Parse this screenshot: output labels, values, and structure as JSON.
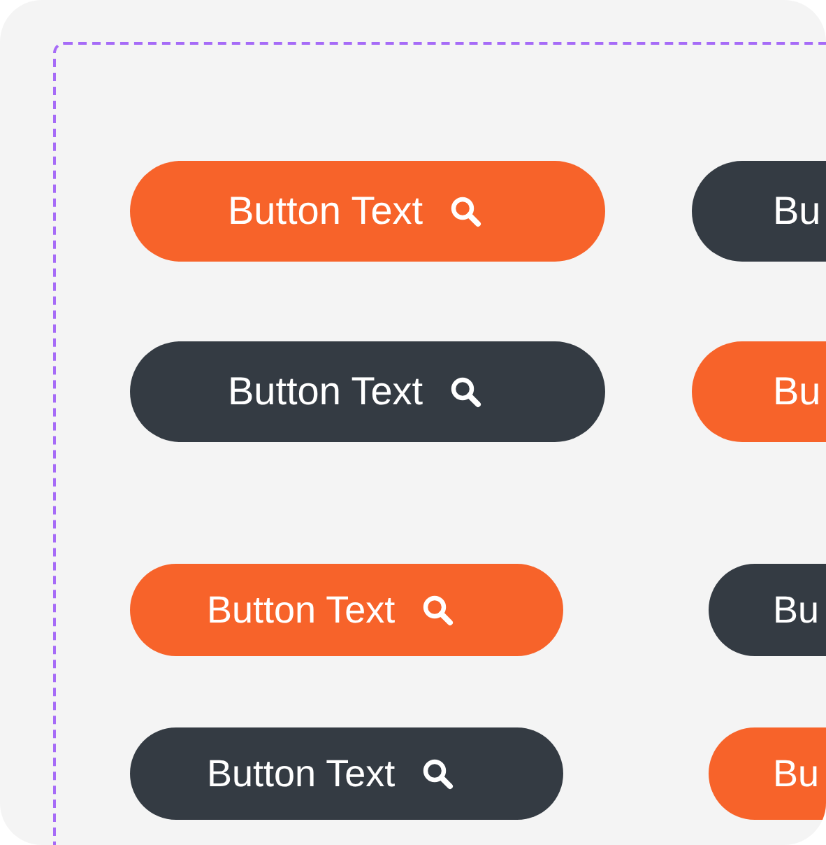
{
  "groups": [
    {
      "kind": "large",
      "rows": [
        [
          {
            "kind": "primary",
            "label": "Button Text",
            "search_icon": true
          },
          {
            "kind": "dark",
            "label": "Bu",
            "search_icon": false
          }
        ],
        [
          {
            "kind": "dark",
            "label": "Button Text",
            "search_icon": true
          },
          {
            "kind": "primary",
            "label": "Bu",
            "search_icon": false
          }
        ]
      ]
    },
    {
      "kind": "small",
      "rows": [
        [
          {
            "kind": "primary",
            "label": "Button Text",
            "search_icon": true
          },
          {
            "kind": "dark",
            "label": "Bu",
            "search_icon": false
          }
        ],
        [
          {
            "kind": "dark",
            "label": "Button Text",
            "search_icon": true
          },
          {
            "kind": "primary",
            "label": "Bu",
            "search_icon": false
          }
        ]
      ]
    }
  ]
}
